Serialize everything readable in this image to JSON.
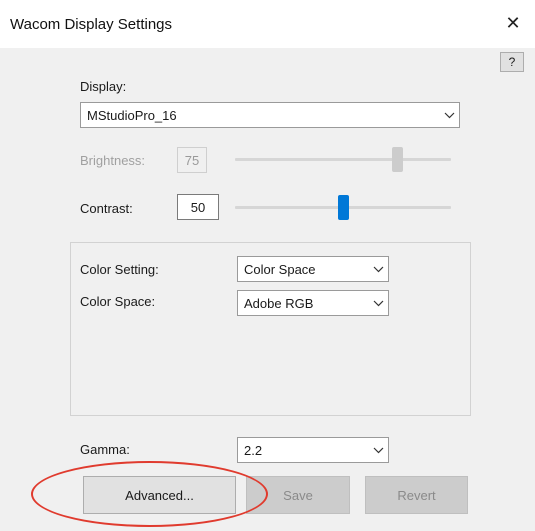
{
  "window": {
    "title": "Wacom Display Settings",
    "close_glyph": "✕",
    "help_label": "?"
  },
  "display": {
    "label": "Display:",
    "selected": "MStudioPro_16"
  },
  "brightness": {
    "label": "Brightness:",
    "value": "75",
    "slider_value": 75,
    "enabled": false
  },
  "contrast": {
    "label": "Contrast:",
    "value": "50",
    "slider_value": 50,
    "enabled": true
  },
  "color": {
    "setting_label": "Color Setting:",
    "setting_selected": "Color Space",
    "space_label": "Color Space:",
    "space_selected": "Adobe RGB"
  },
  "gamma": {
    "label": "Gamma:",
    "selected": "2.2"
  },
  "buttons": {
    "advanced": "Advanced...",
    "save": "Save",
    "revert": "Revert"
  },
  "colors": {
    "accent": "#0078d7",
    "annotation": "#e03b2e"
  },
  "icons": {
    "close": "close-icon",
    "dropdown": "chevron-down-icon"
  }
}
